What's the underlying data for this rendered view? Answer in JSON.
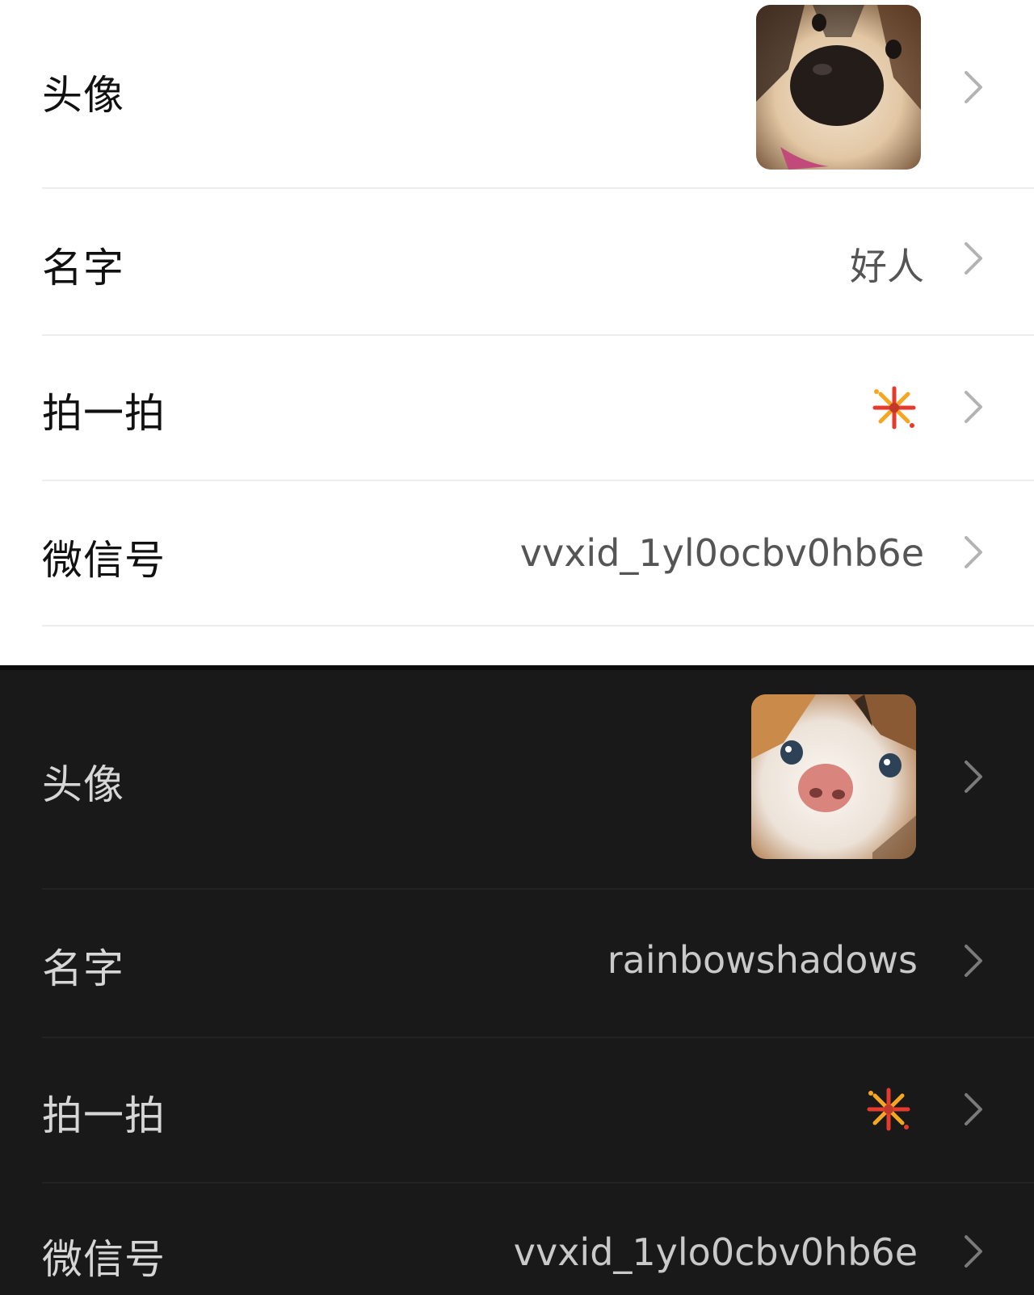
{
  "light": {
    "rows": [
      {
        "label": "头像",
        "avatar": "dog-avatar"
      },
      {
        "label": "名字",
        "value": "好人"
      },
      {
        "label": "拍一拍",
        "icon": "fireworks-icon"
      },
      {
        "label": "微信号",
        "value": "vvxid_1yl0ocbv0hb6e"
      }
    ],
    "colors": {
      "background": "#ffffff",
      "text": "#111111",
      "value": "#555555"
    }
  },
  "dark": {
    "rows": [
      {
        "label": "头像",
        "avatar": "cat-avatar"
      },
      {
        "label": "名字",
        "value": "rainbowshadows"
      },
      {
        "label": "拍一拍",
        "icon": "fireworks-icon"
      },
      {
        "label": "微信号",
        "value": "vvxid_1ylo0cbv0hb6e"
      }
    ],
    "colors": {
      "background": "#191919",
      "text": "#d6d6d6",
      "value": "#c9c9c9"
    }
  }
}
